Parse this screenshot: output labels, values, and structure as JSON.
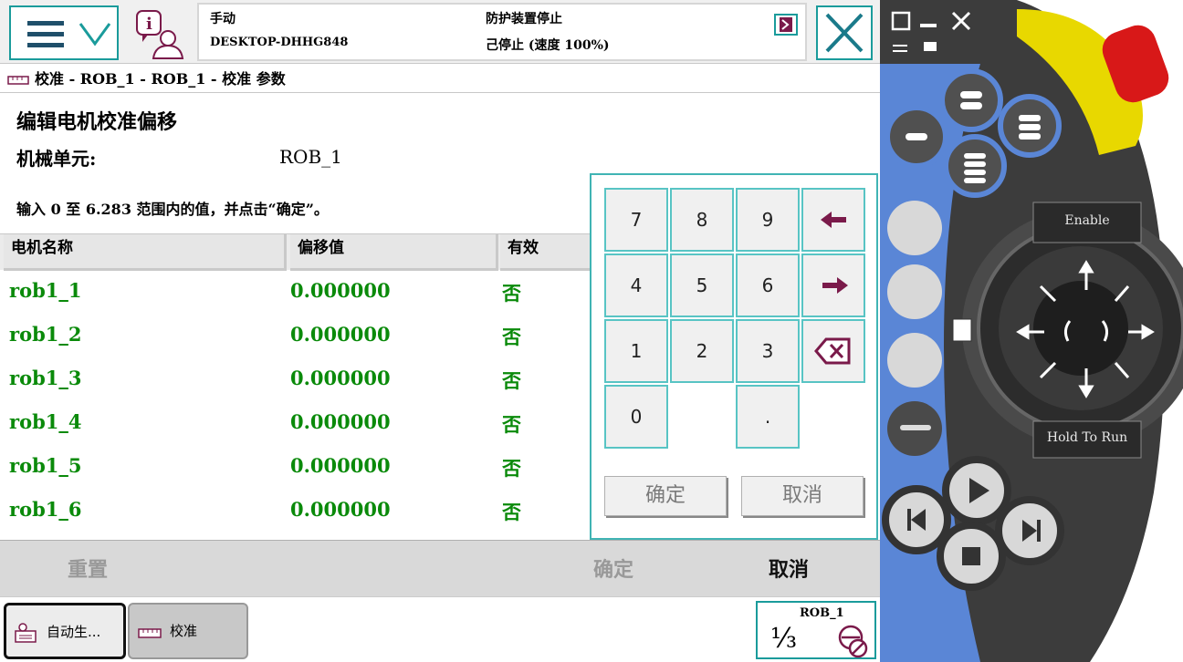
{
  "header": {
    "mode": "手动",
    "host": "DESKTOP-DHHG848",
    "guard_status": "防护装置停止",
    "run_state": "己停止 (速度 100%)"
  },
  "breadcrumb": "校准 - ROB_1 - ROB_1 - 校准 参数",
  "page": {
    "title": "编辑电机校准偏移",
    "unit_label": "机械单元:",
    "unit_value": "ROB_1",
    "instruction": "输入 0 至 6.283 范围内的值，并点击“确定”。"
  },
  "table": {
    "headers": [
      "电机名称",
      "偏移值",
      "有效"
    ],
    "rows": [
      {
        "name": "rob1_1",
        "offset": "0.000000",
        "valid": "否"
      },
      {
        "name": "rob1_2",
        "offset": "0.000000",
        "valid": "否"
      },
      {
        "name": "rob1_3",
        "offset": "0.000000",
        "valid": "否"
      },
      {
        "name": "rob1_4",
        "offset": "0.000000",
        "valid": "否"
      },
      {
        "name": "rob1_5",
        "offset": "0.000000",
        "valid": "否"
      },
      {
        "name": "rob1_6",
        "offset": "0.000000",
        "valid": "否"
      }
    ]
  },
  "numpad": {
    "keys": [
      "7",
      "8",
      "9",
      "4",
      "5",
      "6",
      "1",
      "2",
      "3",
      "0",
      "."
    ],
    "ok_label": "确定",
    "cancel_label": "取消"
  },
  "actions": {
    "reset": "重置",
    "ok": "确定",
    "cancel": "取消"
  },
  "taskbar": {
    "task1": "自动生...",
    "task2": "校准",
    "quickset_unit": "ROB_1",
    "quickset_increment": "⅓"
  },
  "hardware": {
    "enable_label": "Enable",
    "hold_label": "Hold To Run"
  },
  "colors": {
    "accent_teal": "#1a9b9b",
    "value_green": "#0a8a0a",
    "icon_maroon": "#7a1a4a",
    "pendant_blue": "#5a86d6"
  }
}
